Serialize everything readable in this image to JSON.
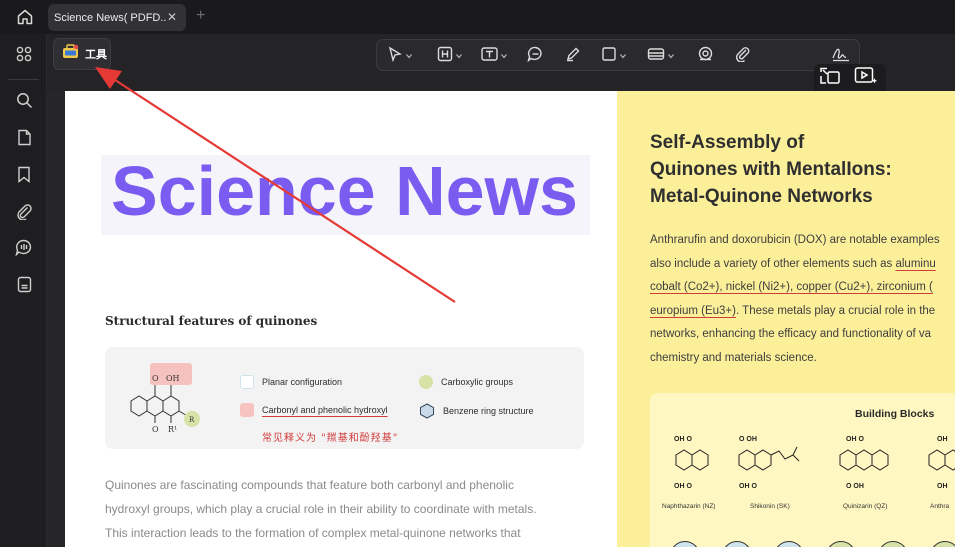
{
  "window": {
    "tab_title": "Science News( PDFD...",
    "tab_close": "✕",
    "tab_add": "+"
  },
  "toolbar": {
    "tools_label": "工具"
  },
  "page_left": {
    "title": "Science News",
    "section_heading": "Structural features of quinones",
    "molecule_labels": {
      "o1": "O",
      "oh": "OH",
      "o2": "O",
      "r1": "R¹",
      "r": "R"
    },
    "legend": [
      {
        "label": "Planar configuration",
        "color": "#ffffff"
      },
      {
        "label": "Carboxylic groups",
        "color": "#d7e2a6"
      },
      {
        "label": "Carbonyl and phenolic hydroxyl",
        "color": "#f7c3c0"
      },
      {
        "label": "Benzene ring structure",
        "color": "#c9d9e8"
      }
    ],
    "handnote": "常见释义为 \"羰基和酚羟基\"",
    "paragraph": [
      "Quinones are fascinating compounds that feature both carbonyl and phenolic",
      "hydroxyl groups, which play a crucial role in their ability to coordinate with metals.",
      "This interaction leads to the formation of complex metal-quinone networks that"
    ]
  },
  "page_right": {
    "heading": [
      "Self-Assembly of",
      "Quinones with MentalIons:",
      "Metal-Quinone Networks"
    ],
    "body": [
      {
        "text": "Anthrarufin and doxorubicin (DOX) are notable examples",
        "underline": ""
      },
      {
        "text": "also include a variety of other elements such as ",
        "underline": "aluminu"
      },
      {
        "text": "",
        "underline": "cobalt (Co2+), nickel (Ni2+), copper (Cu2+), zirconium ("
      },
      {
        "text": ". These metals play a crucial role in the",
        "underline": "europium (Eu3+)"
      },
      {
        "text": "networks, enhancing the efficacy and functionality of va",
        "underline": ""
      },
      {
        "text": "chemistry and materials science.",
        "underline": ""
      }
    ],
    "building_blocks": {
      "title": "Building Blocks",
      "molecules": [
        {
          "top": "OH    O",
          "bottom": "OH    O",
          "label": "Naphthazarin (NZ)"
        },
        {
          "top": "O    OH",
          "bottom": "OH    O",
          "label": "Shikonin (SK)"
        },
        {
          "top": "OH    O",
          "bottom": "O    OH",
          "label": "Quinizarin (QZ)"
        },
        {
          "top": "OH",
          "bottom": "OH",
          "label": "Anthra"
        }
      ]
    }
  },
  "colors": {
    "accent_purple": "#7a5cf0",
    "annotation_red": "#e53935",
    "right_page_yellow": "#fcef9a"
  }
}
